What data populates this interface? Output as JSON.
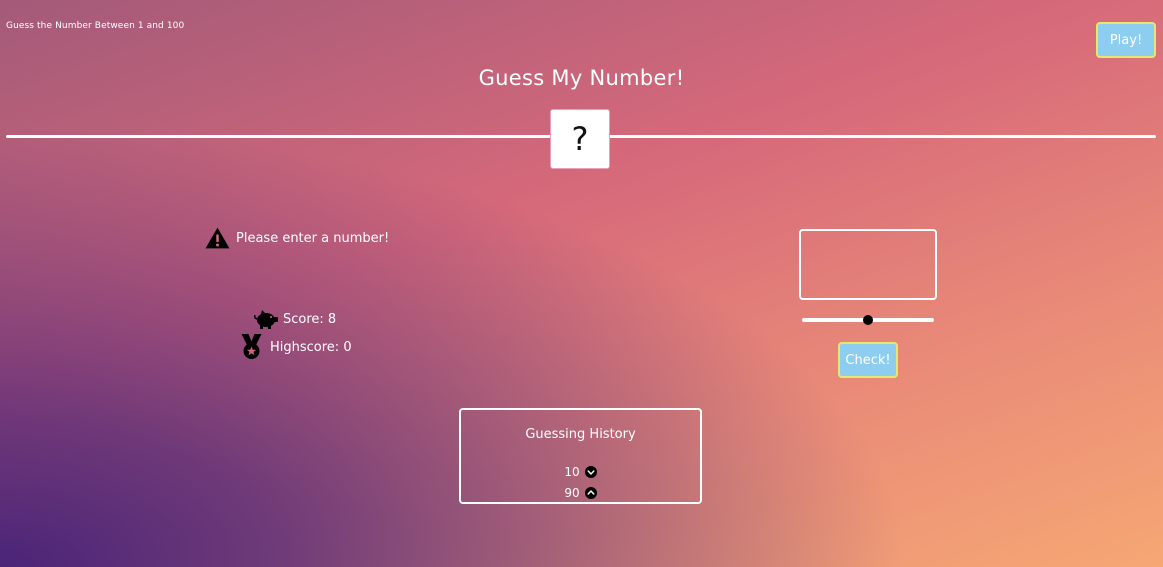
{
  "header": {
    "subtitle": "Guess the Number Between 1 and 100",
    "play_label": "Play!",
    "title": "Guess My Number!"
  },
  "secret": {
    "display": "?"
  },
  "status": {
    "message": "Please enter a number!",
    "icon": "warning-icon"
  },
  "stats": {
    "score_text": "Score: 8",
    "score_icon": "piggy-bank-icon",
    "highscore_text": "Highscore: 0",
    "highscore_icon": "medal-icon"
  },
  "controls": {
    "input_value": "",
    "slider_fraction": 0.5,
    "check_label": "Check!"
  },
  "history": {
    "title": "Guessing History",
    "items": [
      {
        "value": "10",
        "icon": "arrow-down-circle-icon"
      },
      {
        "value": "90",
        "icon": "arrow-up-circle-icon"
      }
    ]
  },
  "colors": {
    "button_bg": "#8ccdf0",
    "button_border": "#e6e86e",
    "gradient_start": "#4a2478",
    "gradient_mid": "#d6697a",
    "gradient_end": "#f6a774"
  }
}
